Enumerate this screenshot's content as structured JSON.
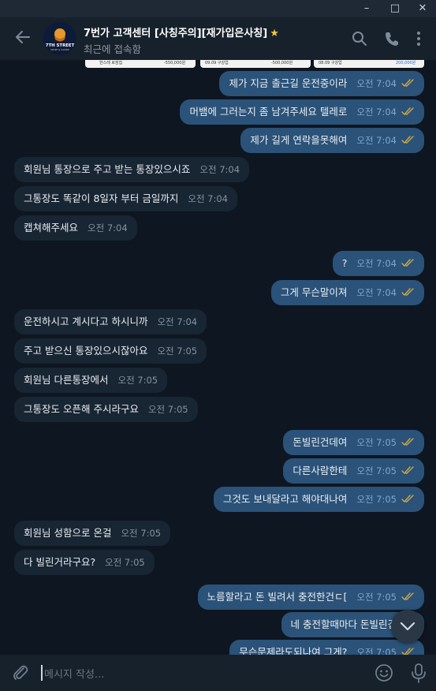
{
  "window": {
    "min_icon": "minimize-icon",
    "max_icon": "maximize-icon",
    "close_icon": "close-icon"
  },
  "header": {
    "title": "7번가 고객센터 [사칭주의][재가입은사칭]",
    "subtitle": "최근에 접속함",
    "avatar_text": "7TH STREET",
    "avatar_subtext": "SPORT & CASINO",
    "icons": [
      "back-arrow-icon",
      "search-icon",
      "phone-icon",
      "more-vertical-icon"
    ]
  },
  "preview_cards": [
    {
      "left": "한스레 로잠집",
      "amount": "-550,000원"
    },
    {
      "left": "09.09 구강업",
      "amount": "-500,000원"
    },
    {
      "left": "08.09 구강업",
      "amount": "200,000원"
    }
  ],
  "messages": [
    {
      "dir": "out",
      "text": "제가 지금 출근길 운전중이라",
      "time": "오전 7:04",
      "read": true
    },
    {
      "dir": "out",
      "text": "머뱀에 그러는지 좀 남겨주세요 텔레로",
      "time": "오전 7:04",
      "read": true
    },
    {
      "dir": "out",
      "text": "제가 길게 연락을못해여",
      "time": "오전 7:04",
      "read": true
    },
    {
      "dir": "in",
      "text": "회원님 통장으로 주고 받는 통장있으시죠",
      "time": "오전 7:04"
    },
    {
      "dir": "in",
      "text": "그통장도 똑같이 8일자 부터 금일까지",
      "time": "오전 7:04"
    },
    {
      "dir": "in",
      "text": "캡쳐해주세요",
      "time": "오전 7:04"
    },
    {
      "dir": "out",
      "text": "?",
      "time": "오전 7:04",
      "read": true
    },
    {
      "dir": "out",
      "text": "그게 무슨말이져",
      "time": "오전 7:04",
      "read": true
    },
    {
      "dir": "in",
      "text": "운전하시고 계시다고 하시니까",
      "time": "오전 7:04"
    },
    {
      "dir": "in",
      "text": "주고 받으신 통장있으시잖아요",
      "time": "오전 7:05"
    },
    {
      "dir": "in",
      "text": "회원님 다른통장에서",
      "time": "오전 7:05"
    },
    {
      "dir": "in",
      "text": "그통장도 오픈해 주시라구요",
      "time": "오전 7:05"
    },
    {
      "dir": "out",
      "text": "돈빌린건데여",
      "time": "오전 7:05",
      "read": true
    },
    {
      "dir": "out",
      "text": "다른사람한테",
      "time": "오전 7:05",
      "read": true
    },
    {
      "dir": "out",
      "text": "그것도 보내달라고 해야대나여",
      "time": "오전 7:05",
      "read": true
    },
    {
      "dir": "in",
      "text": "회원님 성함으로 온걸",
      "time": "오전 7:05"
    },
    {
      "dir": "in",
      "text": "다 빌린거라구요?",
      "time": "오전 7:05"
    },
    {
      "dir": "out",
      "text": "노름할라고 돈 빌려서 충전한건ㄷ[",
      "time": "오전 7:05",
      "read": true
    },
    {
      "dir": "out",
      "text": "네 충전할때마다 돈빌린겁니다",
      "time": "",
      "read": false
    },
    {
      "dir": "out",
      "text": "무슨문제라도되나여 그게?",
      "time": "오전 7:05",
      "read": true
    }
  ],
  "composer": {
    "placeholder": "메시지 작성..."
  },
  "colors": {
    "bg": "#0e1621",
    "header": "#17212b",
    "bubble_in": "#182533",
    "bubble_out": "#2b5278",
    "accent_star": "#f4c542"
  }
}
